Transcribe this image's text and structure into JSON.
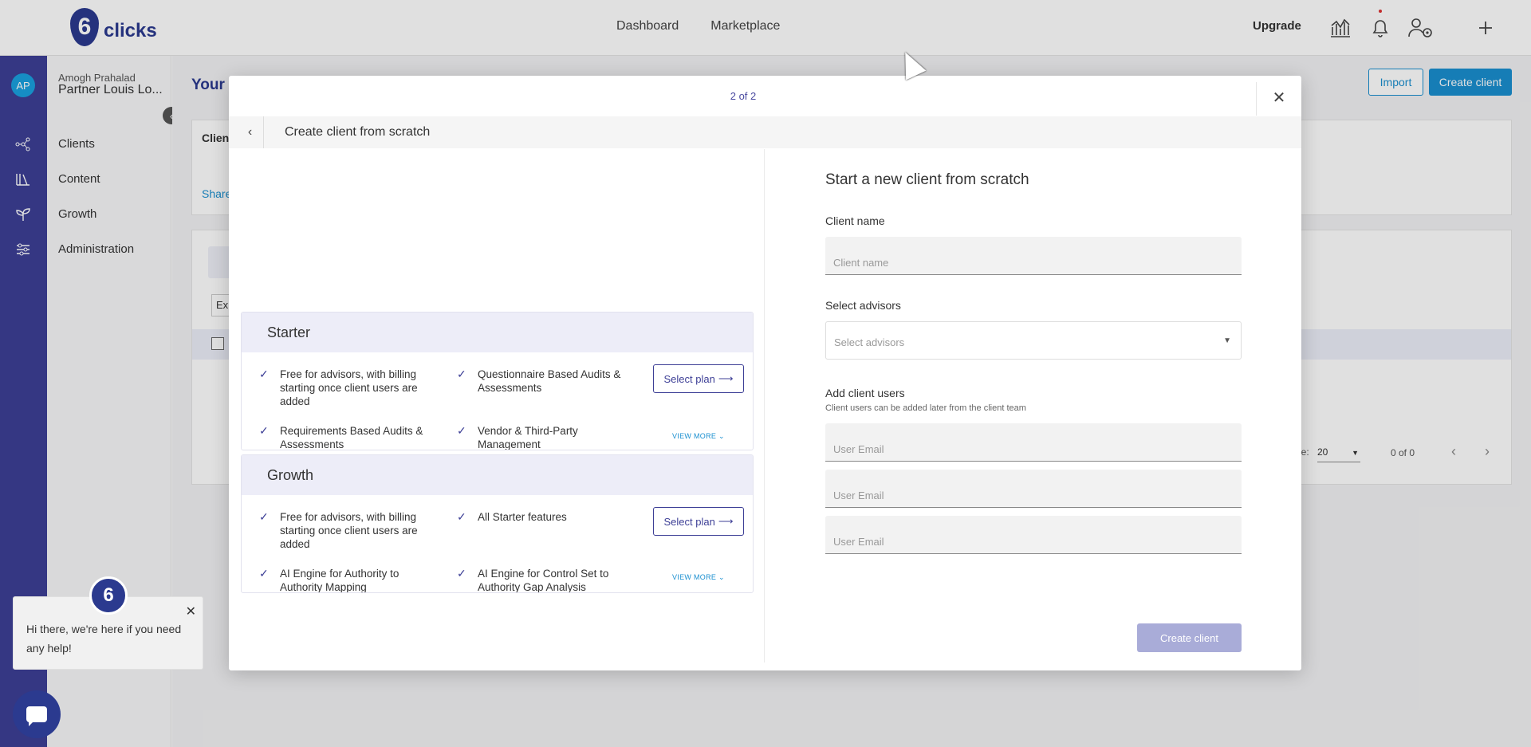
{
  "app": {
    "logo_text": "clicks",
    "logo_mark": "6",
    "nav": [
      "Dashboard",
      "Marketplace"
    ],
    "upgrade_label": "Upgrade",
    "icons": [
      "analytics-icon",
      "bell-icon",
      "user-settings-icon",
      "plus-icon"
    ]
  },
  "sidebar": {
    "avatar_initials": "AP",
    "user_name": "Amogh Prahalad",
    "partner_name": "Partner Louis Lo...",
    "items": [
      {
        "label": "Clients",
        "icon": "network-icon"
      },
      {
        "label": "Content",
        "icon": "library-icon"
      },
      {
        "label": "Growth",
        "icon": "sprout-icon"
      },
      {
        "label": "Administration",
        "icon": "sliders-icon"
      }
    ]
  },
  "page": {
    "title": "Your C",
    "import_label": "Import",
    "create_label": "Create client",
    "card_label": "Client",
    "share_label": "Share",
    "export_label": "Ex",
    "pager": {
      "label": "ge:",
      "page_size": "20",
      "count": "0 of 0"
    }
  },
  "modal": {
    "step": "2 of 2",
    "subtitle": "Create client from scratch",
    "plans": [
      {
        "name": "Starter",
        "features": [
          "Free for advisors, with billing starting once client users are added",
          "Questionnaire Based Audits & Assessments",
          "Requirements Based Audits & Assessments",
          "Vendor & Third-Party Management"
        ],
        "select_label": "Select plan",
        "view_more": "VIEW MORE"
      },
      {
        "name": "Growth",
        "features": [
          "Free for advisors, with billing starting once client users are added",
          "All Starter features",
          "AI Engine for Authority to Authority Mapping",
          "AI Engine for Control Set to Authority Gap Analysis"
        ],
        "select_label": "Select plan",
        "view_more": "VIEW MORE"
      }
    ],
    "form": {
      "title": "Start a new client from scratch",
      "client_name_label": "Client name",
      "client_name_placeholder": "Client name",
      "advisors_label": "Select advisors",
      "advisors_placeholder": "Select advisors",
      "users_label": "Add client users",
      "users_hint": "Client users can be added later from the client team",
      "user_email_placeholder": "User Email",
      "submit_label": "Create client"
    }
  },
  "chat": {
    "message": "Hi there, we're here if you need any help!"
  }
}
